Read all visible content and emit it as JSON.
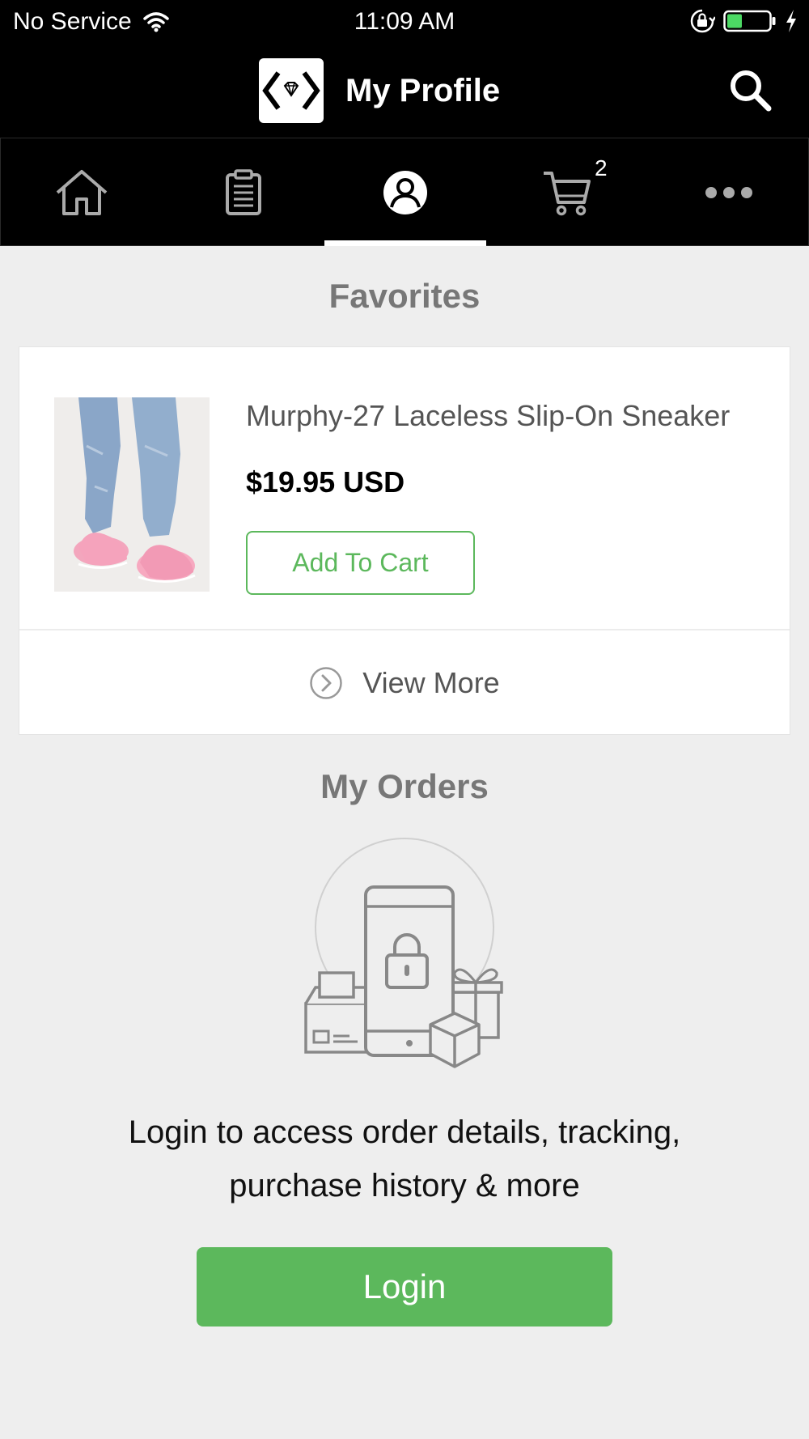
{
  "status_bar": {
    "carrier": "No Service",
    "time": "11:09 AM",
    "icons": [
      "wifi-icon",
      "rotation-lock-icon",
      "battery-icon",
      "charging-icon"
    ]
  },
  "header": {
    "title": "My Profile",
    "logo_icon": "diamond-logo-icon",
    "search_icon": "search-icon"
  },
  "tabs": [
    {
      "name": "home",
      "icon": "home-icon",
      "active": false
    },
    {
      "name": "orders",
      "icon": "clipboard-icon",
      "active": false
    },
    {
      "name": "profile",
      "icon": "profile-icon",
      "active": true
    },
    {
      "name": "cart",
      "icon": "cart-icon",
      "active": false,
      "badge": "2"
    },
    {
      "name": "more",
      "icon": "more-icon",
      "active": false
    }
  ],
  "favorites": {
    "title": "Favorites",
    "item": {
      "name": "Murphy-27 Laceless Slip-On Sneaker",
      "price": "$19.95 USD",
      "add_to_cart_label": "Add To Cart"
    },
    "view_more_label": "View More"
  },
  "orders": {
    "title": "My Orders",
    "message_line1": "Login to access order details, tracking,",
    "message_line2": "purchase history & more",
    "login_label": "Login"
  },
  "colors": {
    "accent": "#5cb85c",
    "header_bg": "#000000",
    "page_bg": "#eeeeee"
  }
}
